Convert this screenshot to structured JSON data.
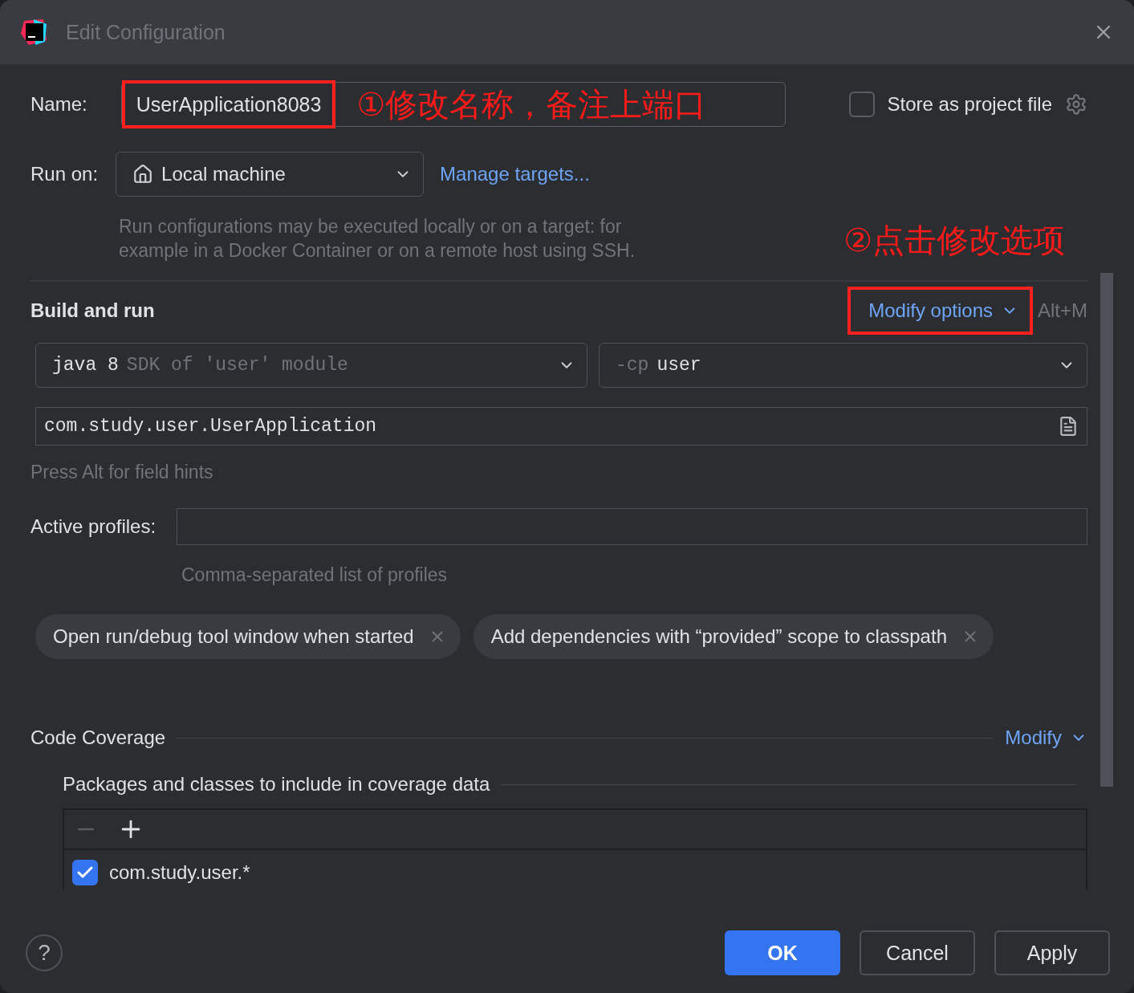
{
  "window": {
    "title": "Edit Configuration"
  },
  "name": {
    "label": "Name:",
    "value": "UserApplication8083",
    "annotation": "①修改名称，备注上端口"
  },
  "store_as_project_file": {
    "label": "Store as project file",
    "checked": false
  },
  "run_on": {
    "label": "Run on:",
    "value": "Local machine",
    "link": "Manage targets...",
    "hint": "Run configurations may be executed locally or on a target: for example in a Docker Container or on a remote host using SSH."
  },
  "annotation": "②点击修改选项",
  "build_and_run": {
    "title": "Build and run",
    "modify_options": "Modify options",
    "shortcut": "Alt+M",
    "sdk": {
      "value": "java 8",
      "hint": "SDK of 'user' module"
    },
    "classpath": {
      "prefix": "-cp",
      "value": "user"
    },
    "main_class": "com.study.user.UserApplication",
    "field_hints": "Press Alt for field hints"
  },
  "active_profiles": {
    "label": "Active profiles:",
    "hint": "Comma-separated list of profiles"
  },
  "options": [
    "Open run/debug tool window when started",
    "Add dependencies with “provided” scope to classpath"
  ],
  "code_coverage": {
    "title": "Code Coverage",
    "modify": "Modify",
    "packages_title": "Packages and classes to include in coverage data",
    "items": [
      {
        "label": "com.study.user.*",
        "checked": true
      }
    ]
  },
  "help": "?",
  "buttons": [
    {
      "label": "OK",
      "kind": "primary"
    },
    {
      "label": "Cancel",
      "kind": "secondary"
    },
    {
      "label": "Apply",
      "kind": "secondary"
    }
  ]
}
